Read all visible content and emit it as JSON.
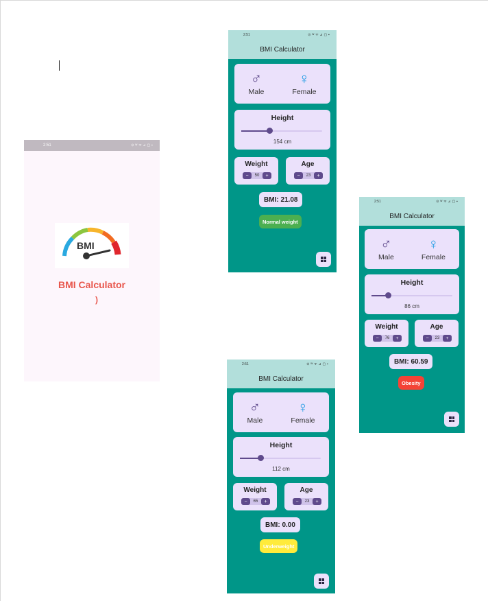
{
  "splash": {
    "time": "2:51",
    "status_icons": "⊙ ᵂ ᯤ ⊿ ▢ ▪",
    "logo_text": "BMI",
    "title": "BMI Calculator",
    "spinner": ")"
  },
  "screens": [
    {
      "time": "2:51",
      "status_icons": "⊙ ᵂ ᯤ ⊿ ▢ ▪",
      "app_title": "BMI Calculator",
      "male_label": "Male",
      "female_label": "Female",
      "height_title": "Height",
      "height_value": "154 cm",
      "height_fraction": 0.35,
      "weight_title": "Weight",
      "weight_value": "50",
      "age_title": "Age",
      "age_value": "23",
      "bmi_text": "BMI: 21.08",
      "category": "Normal weight",
      "category_color": "#4caf50"
    },
    {
      "time": "2:51",
      "status_icons": "⊙ ᵂ ᯤ ⊿ ▢ ▪",
      "app_title": "BMI Calculator",
      "male_label": "Male",
      "female_label": "Female",
      "height_title": "Height",
      "height_value": "86 cm",
      "height_fraction": 0.2,
      "weight_title": "Weight",
      "weight_value": "76",
      "age_title": "Age",
      "age_value": "23",
      "bmi_text": "BMI: 60.59",
      "category": "Obesity",
      "category_color": "#f44336"
    },
    {
      "time": "2:51",
      "status_icons": "⊙ ᵂ ᯤ ⊿ ▢ ▪",
      "app_title": "BMI Calculator",
      "male_label": "Male",
      "female_label": "Female",
      "height_title": "Height",
      "height_value": "112 cm",
      "height_fraction": 0.25,
      "weight_title": "Weight",
      "weight_value": "65",
      "age_title": "Age",
      "age_value": "23",
      "bmi_text": "BMI: 0.00",
      "category": "Underweight",
      "category_color": "#ffeb3b"
    }
  ],
  "stepper": {
    "minus": "−",
    "plus": "+"
  },
  "icons": {
    "male": "♂",
    "female": "♀",
    "fab": "grid-icon"
  }
}
